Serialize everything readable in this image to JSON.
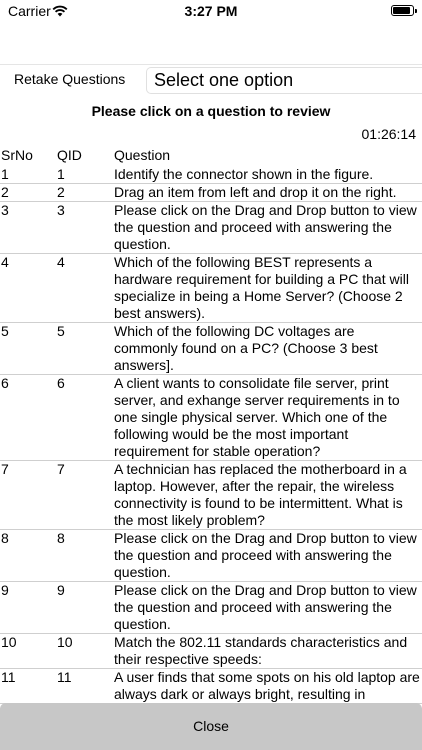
{
  "status_bar": {
    "carrier": "Carrier",
    "time": "3:27 PM",
    "battery_level": 0.9
  },
  "controls": {
    "retake_label": "Retake Questions",
    "select_value": "Select one option"
  },
  "review_title": "Please click on a question to review",
  "timer": "01:26:14",
  "table": {
    "headers": {
      "srno": "SrNo",
      "qid": "QID",
      "question": "Question"
    },
    "rows": [
      {
        "srno": "1",
        "qid": "1",
        "question": "Identify the connector shown in the figure."
      },
      {
        "srno": "2",
        "qid": "2",
        "question": "Drag an item from left and drop it on the right."
      },
      {
        "srno": "3",
        "qid": "3",
        "question": "Please click on the Drag and Drop button to view the question and proceed with answering the question."
      },
      {
        "srno": "4",
        "qid": "4",
        "question": "Which of the following BEST represents a hardware requirement for building a PC that will specialize in being a Home Server? (Choose 2 best answers)."
      },
      {
        "srno": "5",
        "qid": "5",
        "question": "Which of the following DC voltages are commonly found on a PC? (Choose 3 best answers]."
      },
      {
        "srno": "6",
        "qid": "6",
        "question": "A client wants to consolidate file server, print server, and exhange server requirements in to one single physical server. Which one of the following would be the most important requirement for stable operation?"
      },
      {
        "srno": "7",
        "qid": "7",
        "question": "A technician has replaced the motherboard in a laptop. However, after the repair, the wireless connectivity is found to be intermittent. What is the most likely problem?"
      },
      {
        "srno": "8",
        "qid": "8",
        "question": "Please click on the Drag and Drop button to view the question and proceed with answering the question."
      },
      {
        "srno": "9",
        "qid": "9",
        "question": "Please click on the Drag and Drop button to view the question and proceed with answering the question."
      },
      {
        "srno": "10",
        "qid": "10",
        "question": "Match the 802.11 standards characteristics and their respective speeds:"
      },
      {
        "srno": "11",
        "qid": "11",
        "question": "A user finds that some spots on his old laptop are always dark or always bright, resulting in"
      }
    ]
  },
  "close_label": "Close"
}
